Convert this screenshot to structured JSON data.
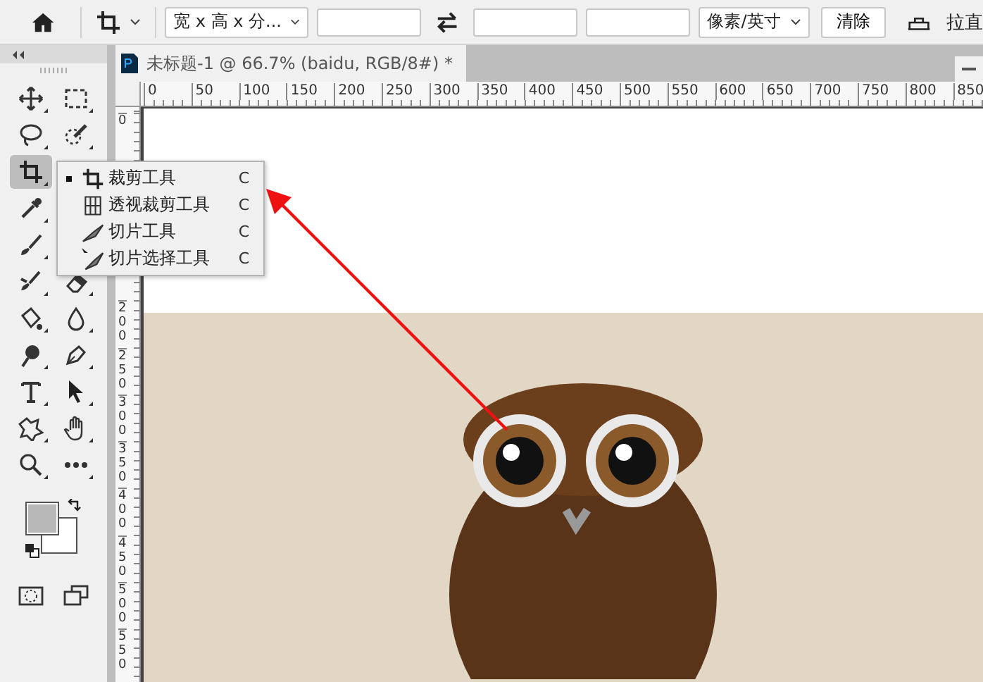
{
  "options_bar": {
    "ratio_select": "宽 x 高 x 分...",
    "unit_select": "像素/英寸",
    "clear_button": "清除",
    "straighten_label": "拉直"
  },
  "toolbar": {
    "rows": [
      {
        "tools": [
          {
            "kind": "move",
            "selected": false
          },
          {
            "kind": "marquee",
            "selected": false
          }
        ]
      },
      {
        "tools": [
          {
            "kind": "lasso",
            "selected": false
          },
          {
            "kind": "quick-select",
            "selected": false
          }
        ]
      },
      {
        "tools": [
          {
            "kind": "crop",
            "selected": true
          }
        ]
      },
      {
        "tools": [
          {
            "kind": "eyedropper",
            "selected": false
          }
        ]
      },
      {
        "tools": [
          {
            "kind": "brush",
            "selected": false
          }
        ]
      },
      {
        "tools": [
          {
            "kind": "stamp",
            "selected": false
          },
          {
            "kind": "eraser",
            "selected": false
          }
        ]
      },
      {
        "tools": [
          {
            "kind": "bucket",
            "selected": false
          },
          {
            "kind": "blur",
            "selected": false
          }
        ]
      },
      {
        "tools": [
          {
            "kind": "dodge",
            "selected": false
          },
          {
            "kind": "pen",
            "selected": false
          }
        ]
      },
      {
        "tools": [
          {
            "kind": "type",
            "selected": false
          },
          {
            "kind": "arrow",
            "selected": false
          }
        ]
      },
      {
        "tools": [
          {
            "kind": "shape",
            "selected": false
          },
          {
            "kind": "hand",
            "selected": false
          }
        ]
      },
      {
        "tools": [
          {
            "kind": "zoom",
            "selected": false
          },
          {
            "kind": "more",
            "selected": false
          }
        ]
      }
    ]
  },
  "flyout_menu": [
    {
      "kind": "crop",
      "label": "裁剪工具",
      "shortcut": "C",
      "selected": true
    },
    {
      "kind": "perspective",
      "label": "透视裁剪工具",
      "shortcut": "C",
      "selected": false
    },
    {
      "kind": "slice",
      "label": "切片工具",
      "shortcut": "C",
      "selected": false
    },
    {
      "kind": "slice-select",
      "label": "切片选择工具",
      "shortcut": "C",
      "selected": false
    }
  ],
  "document_tab": {
    "title": "未标题-1 @ 66.7% (baidu, RGB/8#) *"
  },
  "horizontal_ruler": [
    "0",
    "50",
    "100",
    "150",
    "200",
    "250",
    "300",
    "350",
    "400",
    "450",
    "500",
    "550",
    "600",
    "650",
    "700",
    "750",
    "800",
    "850"
  ],
  "vertical_ruler": [
    "0",
    "200",
    "250",
    "300",
    "350",
    "400",
    "450",
    "500",
    "550"
  ]
}
